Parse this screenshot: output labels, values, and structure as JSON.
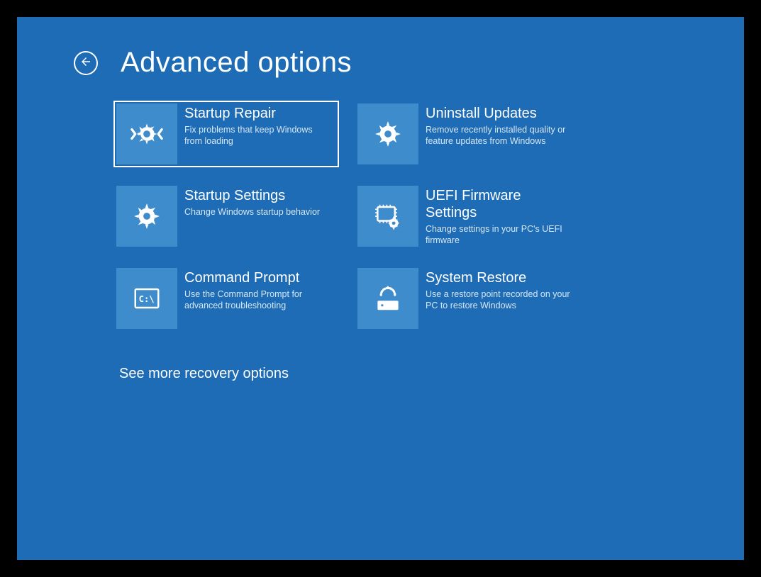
{
  "title": "Advanced options",
  "see_more": "See more recovery options",
  "tiles": [
    {
      "title": "Startup Repair",
      "desc": "Fix problems that keep Windows from loading"
    },
    {
      "title": "Uninstall Updates",
      "desc": "Remove recently installed quality or feature updates from Windows"
    },
    {
      "title": "Startup Settings",
      "desc": "Change Windows startup behavior"
    },
    {
      "title": "UEFI Firmware Settings",
      "desc": "Change settings in your PC's UEFI firmware"
    },
    {
      "title": "Command Prompt",
      "desc": "Use the Command Prompt for advanced troubleshooting"
    },
    {
      "title": "System Restore",
      "desc": "Use a restore point recorded on your PC to restore Windows"
    }
  ]
}
